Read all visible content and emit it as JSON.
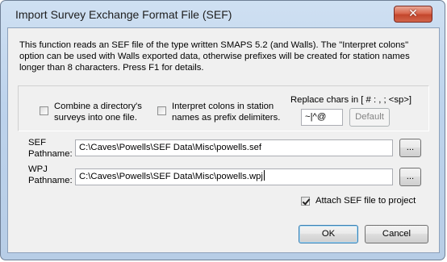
{
  "window": {
    "title": "Import Survey Exchange Format File (SEF)",
    "close_glyph": "✕"
  },
  "description": {
    "line1": "This function reads an SEF file of the type written SMAPS 5.2 (and Walls).  The \"Interpret colons\"",
    "line2": "option can be used with Walls exported data, otherwise prefixes will be created for station names",
    "line3": "longer than 8 characters.  Press F1 for details."
  },
  "options": {
    "combine": {
      "checked": false,
      "label_line1": "Combine a directory's",
      "label_line2": "surveys into one file."
    },
    "interpret_colons": {
      "checked": false,
      "label_line1": "Interpret colons in station",
      "label_line2": "names as prefix delimiters."
    },
    "replace_chars": {
      "label": "Replace chars in [ # : , ; <sp>]",
      "value": "~|^@",
      "default_button": "Default"
    }
  },
  "sef_path": {
    "label_line1": "SEF",
    "label_line2": "Pathname:",
    "value": "C:\\Caves\\Powells\\SEF Data\\Misc\\powells.sef",
    "browse_button": "..."
  },
  "wpj_path": {
    "label_line1": "WPJ",
    "label_line2": "Pathname:",
    "value": "C:\\Caves\\Powells\\SEF Data\\Misc\\powells.wpj",
    "browse_button": "..."
  },
  "attach": {
    "checked": true,
    "label": "Attach SEF file to project"
  },
  "buttons": {
    "ok": "OK",
    "cancel": "Cancel"
  }
}
